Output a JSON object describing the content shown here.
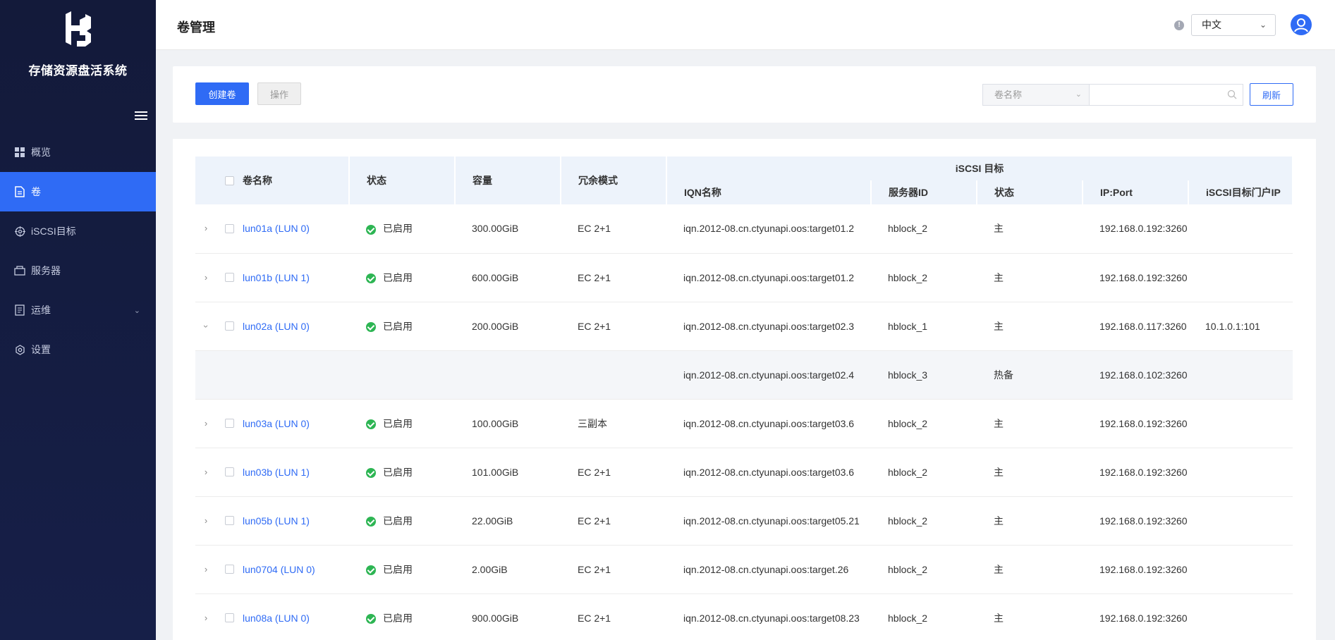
{
  "app": {
    "system_name": "存储资源盘活系统"
  },
  "sidebar": {
    "items": [
      {
        "label": "概览",
        "icon": "dashboard-icon",
        "active": false
      },
      {
        "label": "卷",
        "icon": "document-icon",
        "active": true
      },
      {
        "label": "iSCSI目标",
        "icon": "target-icon",
        "active": false
      },
      {
        "label": "服务器",
        "icon": "server-icon",
        "active": false
      },
      {
        "label": "运维",
        "icon": "maintenance-icon",
        "active": false,
        "expandable": true
      },
      {
        "label": "设置",
        "icon": "gear-icon",
        "active": false
      }
    ]
  },
  "header": {
    "title": "卷管理",
    "language": "中文"
  },
  "toolbar": {
    "create_label": "创建卷",
    "action_label": "操作",
    "search_field": "卷名称",
    "search_placeholder": "",
    "refresh_label": "刷新"
  },
  "table": {
    "columns": {
      "name": "卷名称",
      "status": "状态",
      "capacity": "容量",
      "redundancy": "冗余模式",
      "iscsi_group": "iSCSI 目标",
      "iqn": "IQN名称",
      "server_id": "服务器ID",
      "target_status": "状态",
      "ip_port": "IP:Port",
      "portal_ip": "iSCSI目标门户IP"
    },
    "rows": [
      {
        "name": "lun01a (LUN 0)",
        "status": "已启用",
        "capacity": "300.00GiB",
        "redundancy": "EC 2+1",
        "iqn": "iqn.2012-08.cn.ctyunapi.oos:target01.2",
        "server_id": "hblock_2",
        "target_status": "主",
        "ip_port": "192.168.0.192:3260",
        "portal_ip": ""
      },
      {
        "name": "lun01b (LUN 1)",
        "status": "已启用",
        "capacity": "600.00GiB",
        "redundancy": "EC 2+1",
        "iqn": "iqn.2012-08.cn.ctyunapi.oos:target01.2",
        "server_id": "hblock_2",
        "target_status": "主",
        "ip_port": "192.168.0.192:3260",
        "portal_ip": ""
      },
      {
        "name": "lun02a (LUN 0)",
        "status": "已启用",
        "capacity": "200.00GiB",
        "redundancy": "EC 2+1",
        "iqn": "iqn.2012-08.cn.ctyunapi.oos:target02.3",
        "server_id": "hblock_1",
        "target_status": "主",
        "ip_port": "192.168.0.117:3260",
        "portal_ip": "10.1.0.1:101",
        "expanded": true
      },
      {
        "sub": true,
        "iqn": "iqn.2012-08.cn.ctyunapi.oos:target02.4",
        "server_id": "hblock_3",
        "target_status": "热备",
        "ip_port": "192.168.0.102:3260",
        "portal_ip": ""
      },
      {
        "name": "lun03a (LUN 0)",
        "status": "已启用",
        "capacity": "100.00GiB",
        "redundancy": "三副本",
        "iqn": "iqn.2012-08.cn.ctyunapi.oos:target03.6",
        "server_id": "hblock_2",
        "target_status": "主",
        "ip_port": "192.168.0.192:3260",
        "portal_ip": ""
      },
      {
        "name": "lun03b (LUN 1)",
        "status": "已启用",
        "capacity": "101.00GiB",
        "redundancy": "EC 2+1",
        "iqn": "iqn.2012-08.cn.ctyunapi.oos:target03.6",
        "server_id": "hblock_2",
        "target_status": "主",
        "ip_port": "192.168.0.192:3260",
        "portal_ip": ""
      },
      {
        "name": "lun05b (LUN 1)",
        "status": "已启用",
        "capacity": "22.00GiB",
        "redundancy": "EC 2+1",
        "iqn": "iqn.2012-08.cn.ctyunapi.oos:target05.21",
        "server_id": "hblock_2",
        "target_status": "主",
        "ip_port": "192.168.0.192:3260",
        "portal_ip": ""
      },
      {
        "name": "lun0704 (LUN 0)",
        "status": "已启用",
        "capacity": "2.00GiB",
        "redundancy": "EC 2+1",
        "iqn": "iqn.2012-08.cn.ctyunapi.oos:target.26",
        "server_id": "hblock_2",
        "target_status": "主",
        "ip_port": "192.168.0.192:3260",
        "portal_ip": ""
      },
      {
        "name": "lun08a (LUN 0)",
        "status": "已启用",
        "capacity": "900.00GiB",
        "redundancy": "EC 2+1",
        "iqn": "iqn.2012-08.cn.ctyunapi.oos:target08.23",
        "server_id": "hblock_2",
        "target_status": "主",
        "ip_port": "192.168.0.192:3260",
        "portal_ip": ""
      }
    ]
  },
  "colors": {
    "accent": "#2f6bf5",
    "sidebar_bg": "#161f48",
    "success": "#2db553"
  }
}
